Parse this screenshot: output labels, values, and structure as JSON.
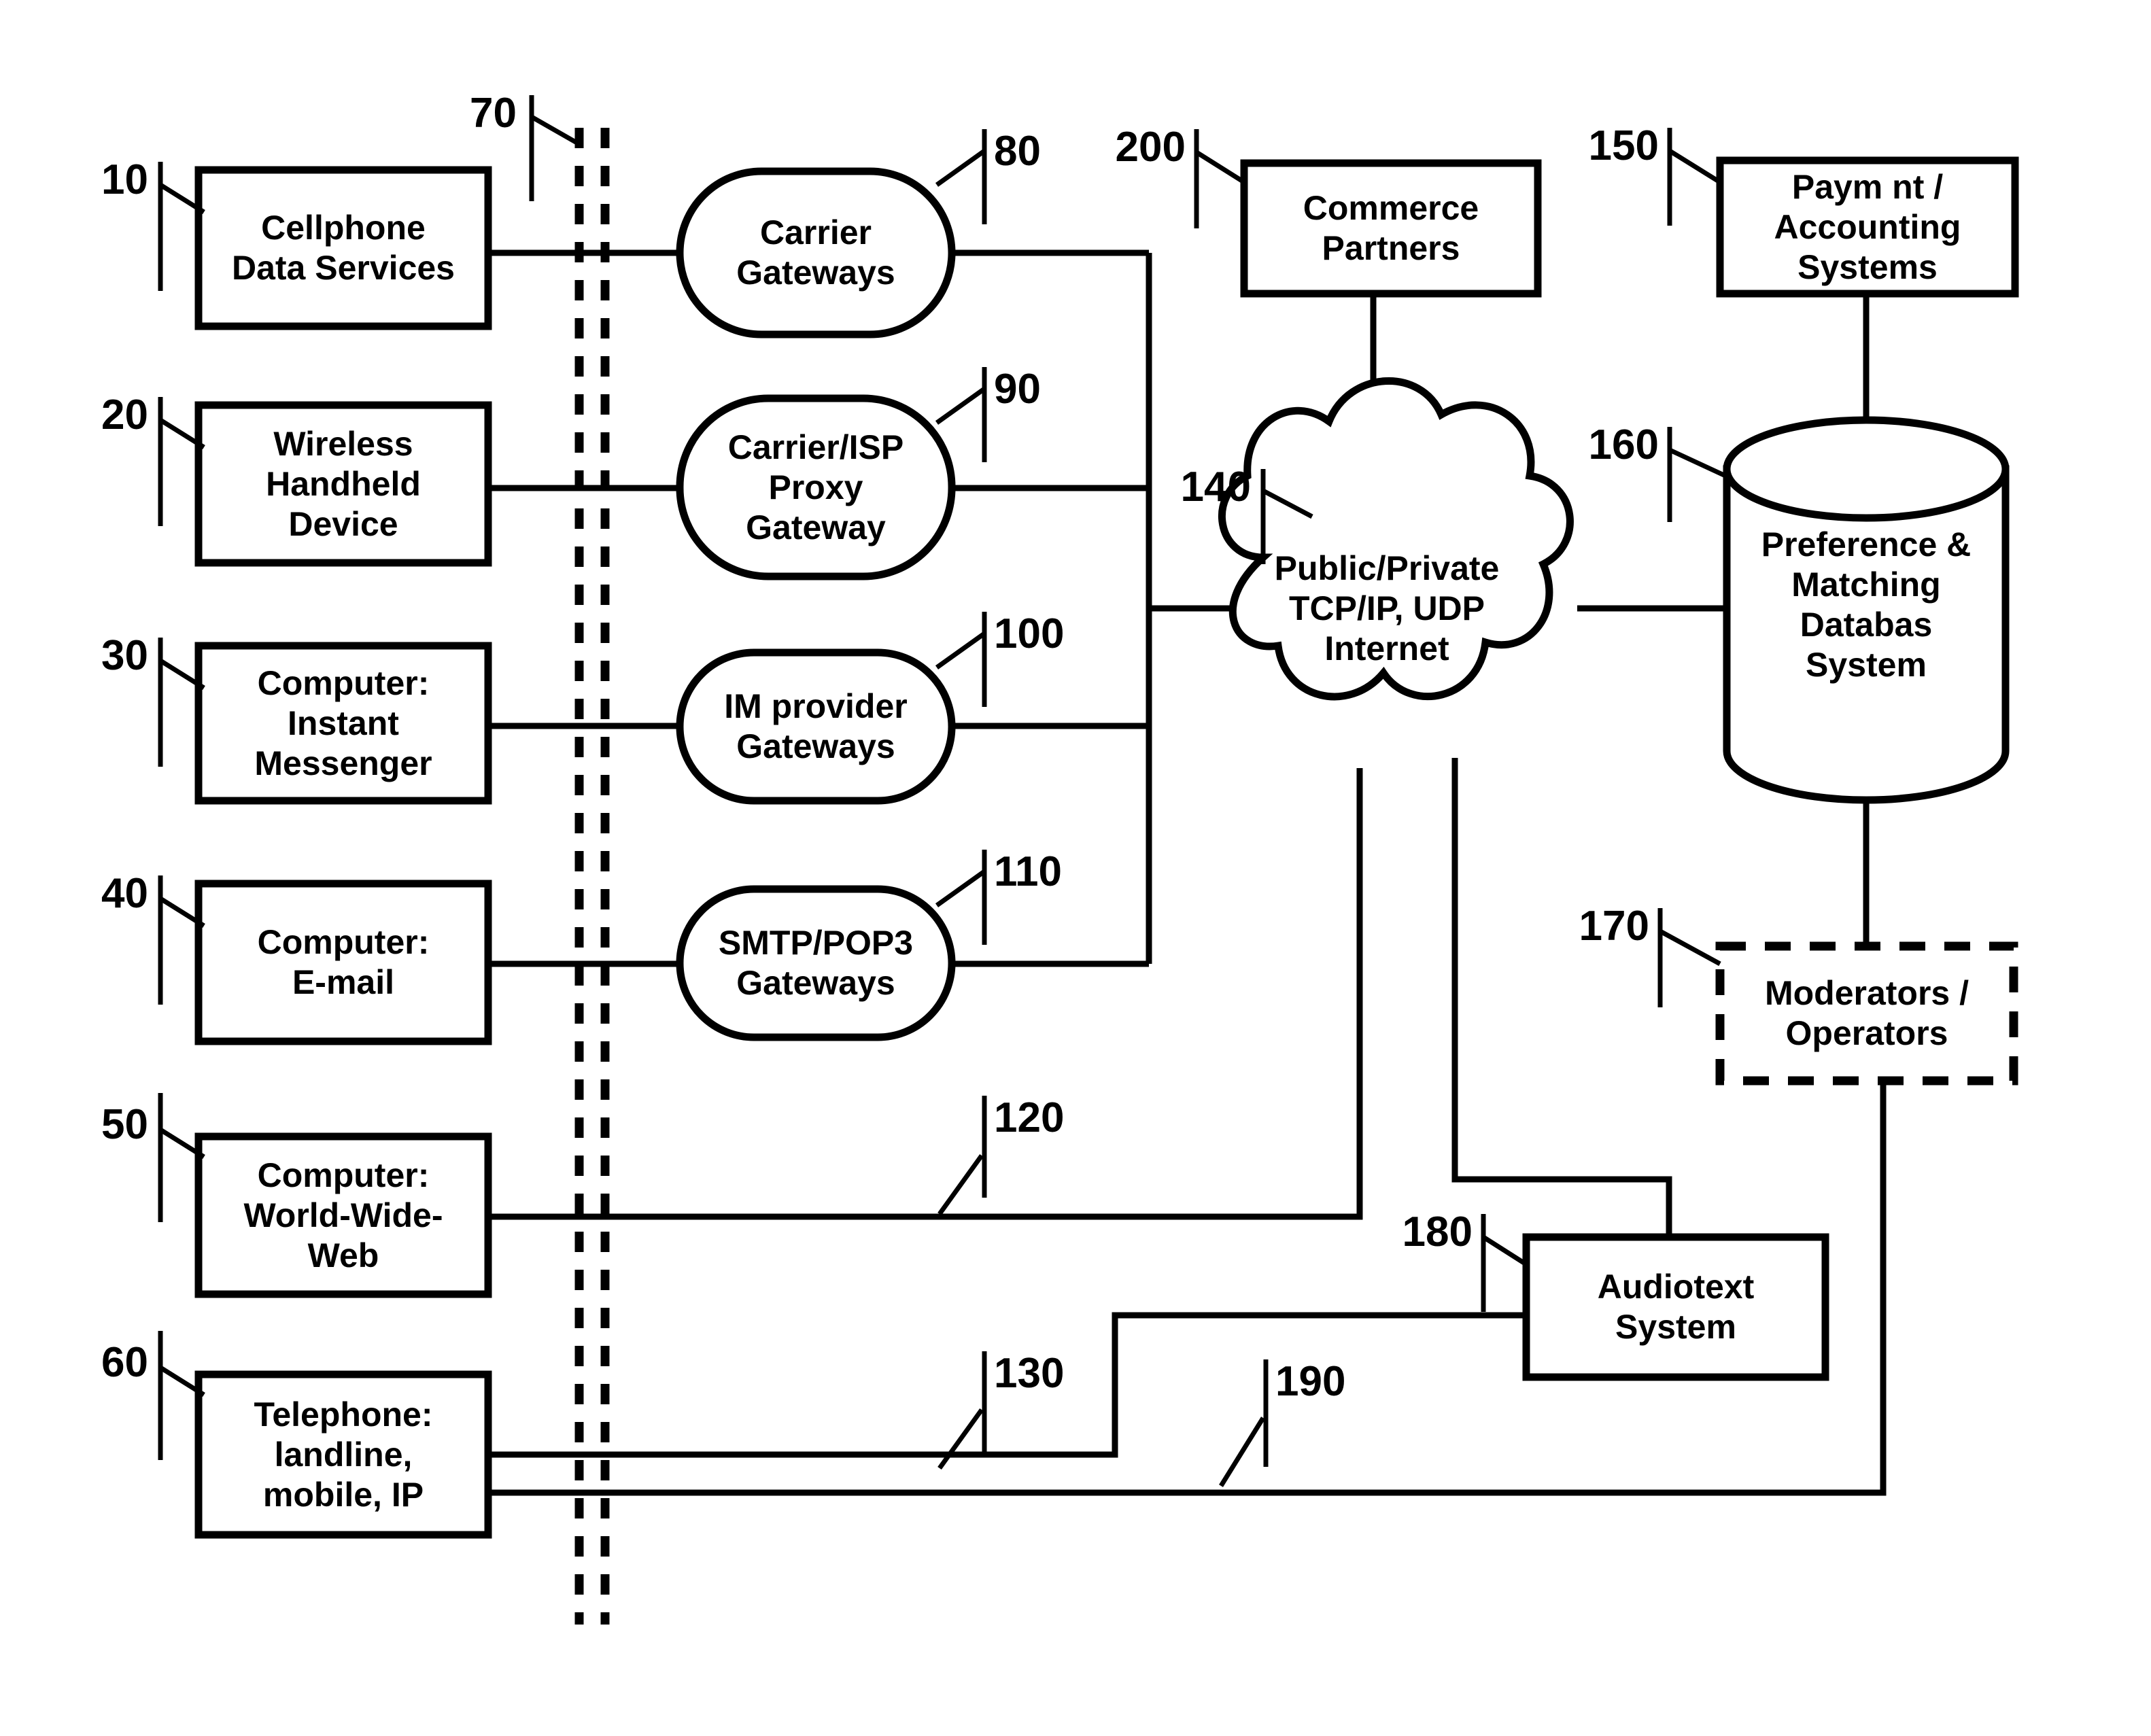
{
  "figure": {
    "type": "patent-block-diagram",
    "background_color": "#ffffff",
    "line_color": "#000000",
    "text_color": "#000000"
  },
  "nodes": {
    "cellphone_data_services": {
      "label": "Cellphone\nData Services",
      "shape": "rect",
      "ref": "10"
    },
    "wireless_handheld_device": {
      "label": "Wireless\nHandheld\nDevice",
      "shape": "rect",
      "ref": "20"
    },
    "computer_instant_messenger": {
      "label": "Computer:\nInstant\nMessenger",
      "shape": "rect",
      "ref": "30"
    },
    "computer_email": {
      "label": "Computer:\nE-mail",
      "shape": "rect",
      "ref": "40"
    },
    "computer_world_wide_web": {
      "label": "Computer:\nWorld-Wide-\nWeb",
      "shape": "rect",
      "ref": "50"
    },
    "telephone": {
      "label": "Telephone:\nlandline,\nmobile, IP",
      "shape": "rect",
      "ref": "60"
    },
    "carrier_gateways": {
      "label": "Carrier\nGateways",
      "shape": "stadium",
      "ref": "80"
    },
    "carrier_isp_proxy_gateway": {
      "label": "Carrier/ISP\nProxy\nGateway",
      "shape": "stadium",
      "ref": "90"
    },
    "im_provider_gateways": {
      "label": "IM provider\nGateways",
      "shape": "stadium",
      "ref": "100"
    },
    "smtp_pop3_gateways": {
      "label": "SMTP/POP3\nGateways",
      "shape": "stadium",
      "ref": "110"
    },
    "internet_cloud": {
      "label": "Public/Private\nTCP/IP, UDP\nInternet",
      "shape": "cloud",
      "ref": "140"
    },
    "commerce_partners": {
      "label": "Commerce\nPartners",
      "shape": "rect",
      "ref": "200"
    },
    "payment_accounting_systems": {
      "label": "Paym nt /\nAccounting\nSystems",
      "shape": "rect",
      "ref": "150"
    },
    "preference_matching_database": {
      "label": "Preference &\nMatching\nDatabas\nSystem",
      "shape": "cylinder",
      "ref": "160"
    },
    "moderators_operators": {
      "label": "Moderators /\nOperators",
      "shape": "dashed-rect",
      "ref": "170"
    },
    "audiotext_system": {
      "label": "Audiotext\nSystem",
      "shape": "rect",
      "ref": "180"
    }
  },
  "reference_numerals": [
    {
      "id": "ref-10",
      "value": "10",
      "points_to": "cellphone_data_services"
    },
    {
      "id": "ref-20",
      "value": "20",
      "points_to": "wireless_handheld_device"
    },
    {
      "id": "ref-30",
      "value": "30",
      "points_to": "computer_instant_messenger"
    },
    {
      "id": "ref-40",
      "value": "40",
      "points_to": "computer_email"
    },
    {
      "id": "ref-50",
      "value": "50",
      "points_to": "computer_world_wide_web"
    },
    {
      "id": "ref-60",
      "value": "60",
      "points_to": "telephone"
    },
    {
      "id": "ref-70",
      "value": "70",
      "points_to": "boundary-dashed-lines"
    },
    {
      "id": "ref-80",
      "value": "80",
      "points_to": "carrier_gateways"
    },
    {
      "id": "ref-90",
      "value": "90",
      "points_to": "carrier_isp_proxy_gateway"
    },
    {
      "id": "ref-100",
      "value": "100",
      "points_to": "im_provider_gateways"
    },
    {
      "id": "ref-110",
      "value": "110",
      "points_to": "smtp_pop3_gateways"
    },
    {
      "id": "ref-120",
      "value": "120",
      "points_to": "web-connection-line"
    },
    {
      "id": "ref-130",
      "value": "130",
      "points_to": "telephone-connection-line-upper"
    },
    {
      "id": "ref-140",
      "value": "140",
      "points_to": "internet_cloud"
    },
    {
      "id": "ref-150",
      "value": "150",
      "points_to": "payment_accounting_systems"
    },
    {
      "id": "ref-160",
      "value": "160",
      "points_to": "preference_matching_database"
    },
    {
      "id": "ref-170",
      "value": "170",
      "points_to": "moderators_operators"
    },
    {
      "id": "ref-180",
      "value": "180",
      "points_to": "audiotext_system"
    },
    {
      "id": "ref-190",
      "value": "190",
      "points_to": "telephone-connection-line-lower"
    },
    {
      "id": "ref-200",
      "value": "200",
      "points_to": "commerce_partners"
    }
  ],
  "connections": [
    {
      "from": "cellphone_data_services",
      "to": "carrier_gateways"
    },
    {
      "from": "wireless_handheld_device",
      "to": "carrier_isp_proxy_gateway"
    },
    {
      "from": "computer_instant_messenger",
      "to": "im_provider_gateways"
    },
    {
      "from": "computer_email",
      "to": "smtp_pop3_gateways"
    },
    {
      "from": "carrier_gateways",
      "to": "internet_cloud"
    },
    {
      "from": "carrier_isp_proxy_gateway",
      "to": "internet_cloud"
    },
    {
      "from": "im_provider_gateways",
      "to": "internet_cloud"
    },
    {
      "from": "smtp_pop3_gateways",
      "to": "internet_cloud"
    },
    {
      "from": "computer_world_wide_web",
      "to": "internet_cloud"
    },
    {
      "from": "commerce_partners",
      "to": "internet_cloud"
    },
    {
      "from": "internet_cloud",
      "to": "preference_matching_database"
    },
    {
      "from": "payment_accounting_systems",
      "to": "preference_matching_database"
    },
    {
      "from": "preference_matching_database",
      "to": "moderators_operators"
    },
    {
      "from": "internet_cloud",
      "to": "audiotext_system"
    },
    {
      "from": "telephone",
      "to": "audiotext_system"
    },
    {
      "from": "telephone",
      "to": "moderators_operators"
    }
  ]
}
